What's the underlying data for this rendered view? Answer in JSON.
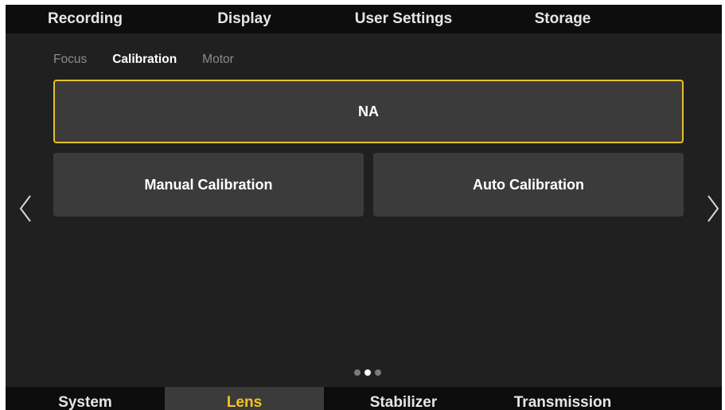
{
  "top_tabs": [
    "Recording",
    "Display",
    "User Settings",
    "Storage"
  ],
  "sub_tabs": [
    "Focus",
    "Calibration",
    "Motor"
  ],
  "active_sub_tab": "Calibration",
  "buttons": {
    "na": "NA",
    "manual": "Manual Calibration",
    "auto": "Auto Calibration"
  },
  "page_indicator": {
    "pages": 3,
    "current": 2
  },
  "bottom_tabs": [
    "System",
    "Lens",
    "Stabilizer",
    "Transmission"
  ],
  "active_bottom_tab": "Lens",
  "colors": {
    "accent": "#f5c518",
    "selection_border": "#e6c02a",
    "background": "#202020",
    "bar": "#0d0d0d",
    "button": "#3b3b3b"
  },
  "icons": {
    "prev": "chevron-left-icon",
    "next": "chevron-right-icon"
  }
}
